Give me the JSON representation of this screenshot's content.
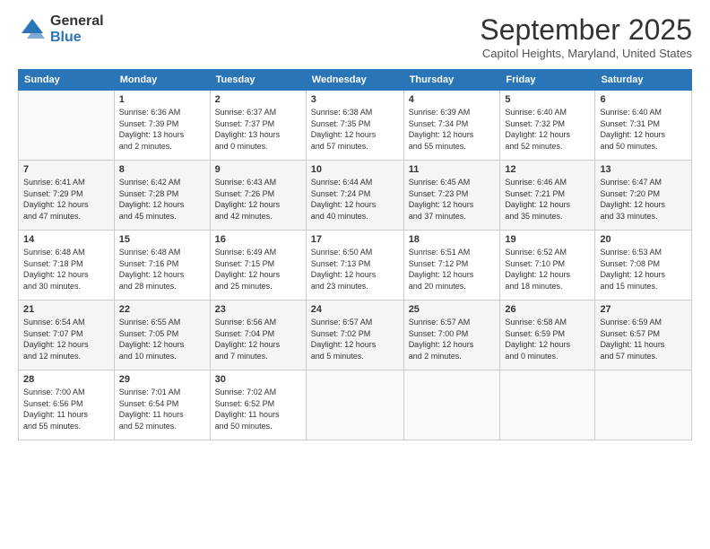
{
  "header": {
    "logo_general": "General",
    "logo_blue": "Blue",
    "month": "September 2025",
    "location": "Capitol Heights, Maryland, United States"
  },
  "days_of_week": [
    "Sunday",
    "Monday",
    "Tuesday",
    "Wednesday",
    "Thursday",
    "Friday",
    "Saturday"
  ],
  "weeks": [
    [
      {
        "day": "",
        "info": ""
      },
      {
        "day": "1",
        "info": "Sunrise: 6:36 AM\nSunset: 7:39 PM\nDaylight: 13 hours\nand 2 minutes."
      },
      {
        "day": "2",
        "info": "Sunrise: 6:37 AM\nSunset: 7:37 PM\nDaylight: 13 hours\nand 0 minutes."
      },
      {
        "day": "3",
        "info": "Sunrise: 6:38 AM\nSunset: 7:35 PM\nDaylight: 12 hours\nand 57 minutes."
      },
      {
        "day": "4",
        "info": "Sunrise: 6:39 AM\nSunset: 7:34 PM\nDaylight: 12 hours\nand 55 minutes."
      },
      {
        "day": "5",
        "info": "Sunrise: 6:40 AM\nSunset: 7:32 PM\nDaylight: 12 hours\nand 52 minutes."
      },
      {
        "day": "6",
        "info": "Sunrise: 6:40 AM\nSunset: 7:31 PM\nDaylight: 12 hours\nand 50 minutes."
      }
    ],
    [
      {
        "day": "7",
        "info": "Sunrise: 6:41 AM\nSunset: 7:29 PM\nDaylight: 12 hours\nand 47 minutes."
      },
      {
        "day": "8",
        "info": "Sunrise: 6:42 AM\nSunset: 7:28 PM\nDaylight: 12 hours\nand 45 minutes."
      },
      {
        "day": "9",
        "info": "Sunrise: 6:43 AM\nSunset: 7:26 PM\nDaylight: 12 hours\nand 42 minutes."
      },
      {
        "day": "10",
        "info": "Sunrise: 6:44 AM\nSunset: 7:24 PM\nDaylight: 12 hours\nand 40 minutes."
      },
      {
        "day": "11",
        "info": "Sunrise: 6:45 AM\nSunset: 7:23 PM\nDaylight: 12 hours\nand 37 minutes."
      },
      {
        "day": "12",
        "info": "Sunrise: 6:46 AM\nSunset: 7:21 PM\nDaylight: 12 hours\nand 35 minutes."
      },
      {
        "day": "13",
        "info": "Sunrise: 6:47 AM\nSunset: 7:20 PM\nDaylight: 12 hours\nand 33 minutes."
      }
    ],
    [
      {
        "day": "14",
        "info": "Sunrise: 6:48 AM\nSunset: 7:18 PM\nDaylight: 12 hours\nand 30 minutes."
      },
      {
        "day": "15",
        "info": "Sunrise: 6:48 AM\nSunset: 7:16 PM\nDaylight: 12 hours\nand 28 minutes."
      },
      {
        "day": "16",
        "info": "Sunrise: 6:49 AM\nSunset: 7:15 PM\nDaylight: 12 hours\nand 25 minutes."
      },
      {
        "day": "17",
        "info": "Sunrise: 6:50 AM\nSunset: 7:13 PM\nDaylight: 12 hours\nand 23 minutes."
      },
      {
        "day": "18",
        "info": "Sunrise: 6:51 AM\nSunset: 7:12 PM\nDaylight: 12 hours\nand 20 minutes."
      },
      {
        "day": "19",
        "info": "Sunrise: 6:52 AM\nSunset: 7:10 PM\nDaylight: 12 hours\nand 18 minutes."
      },
      {
        "day": "20",
        "info": "Sunrise: 6:53 AM\nSunset: 7:08 PM\nDaylight: 12 hours\nand 15 minutes."
      }
    ],
    [
      {
        "day": "21",
        "info": "Sunrise: 6:54 AM\nSunset: 7:07 PM\nDaylight: 12 hours\nand 12 minutes."
      },
      {
        "day": "22",
        "info": "Sunrise: 6:55 AM\nSunset: 7:05 PM\nDaylight: 12 hours\nand 10 minutes."
      },
      {
        "day": "23",
        "info": "Sunrise: 6:56 AM\nSunset: 7:04 PM\nDaylight: 12 hours\nand 7 minutes."
      },
      {
        "day": "24",
        "info": "Sunrise: 6:57 AM\nSunset: 7:02 PM\nDaylight: 12 hours\nand 5 minutes."
      },
      {
        "day": "25",
        "info": "Sunrise: 6:57 AM\nSunset: 7:00 PM\nDaylight: 12 hours\nand 2 minutes."
      },
      {
        "day": "26",
        "info": "Sunrise: 6:58 AM\nSunset: 6:59 PM\nDaylight: 12 hours\nand 0 minutes."
      },
      {
        "day": "27",
        "info": "Sunrise: 6:59 AM\nSunset: 6:57 PM\nDaylight: 11 hours\nand 57 minutes."
      }
    ],
    [
      {
        "day": "28",
        "info": "Sunrise: 7:00 AM\nSunset: 6:56 PM\nDaylight: 11 hours\nand 55 minutes."
      },
      {
        "day": "29",
        "info": "Sunrise: 7:01 AM\nSunset: 6:54 PM\nDaylight: 11 hours\nand 52 minutes."
      },
      {
        "day": "30",
        "info": "Sunrise: 7:02 AM\nSunset: 6:52 PM\nDaylight: 11 hours\nand 50 minutes."
      },
      {
        "day": "",
        "info": ""
      },
      {
        "day": "",
        "info": ""
      },
      {
        "day": "",
        "info": ""
      },
      {
        "day": "",
        "info": ""
      }
    ]
  ]
}
